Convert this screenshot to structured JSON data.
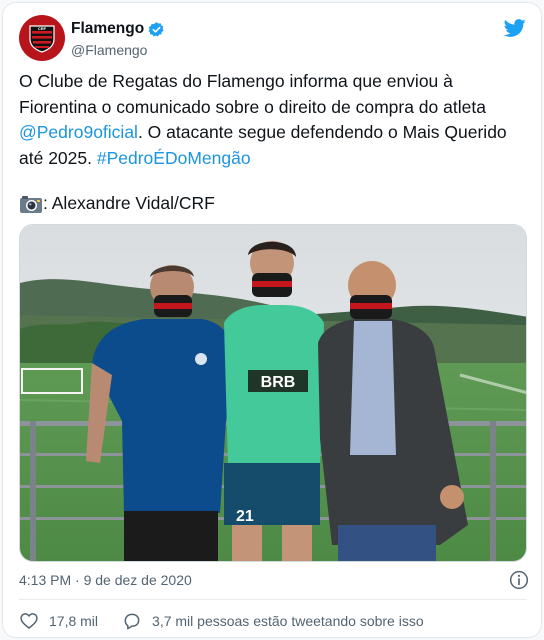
{
  "header": {
    "display_name": "Flamengo",
    "handle": "@Flamengo",
    "avatar_icon": "flamengo-crest-icon",
    "verified_icon": "verified-badge-icon",
    "platform_icon": "twitter-bird-icon"
  },
  "tweet": {
    "text_part1": "O Clube de Regatas do Flamengo informa que enviou à Fiorentina o comunicado sobre o direito de compra do atleta ",
    "mention": "@Pedro9oficial",
    "text_part2": ". O atacante segue defendendo o Mais Querido até 2025. ",
    "hashtag": "#PedroÉDoMengão",
    "credit_icon": "camera-icon",
    "credit_text": ": Alexandre Vidal/CRF"
  },
  "photo": {
    "shirt_sponsor": "BRB",
    "shorts_number": "21"
  },
  "meta": {
    "timestamp": "4:13 PM · 9 de dez de 2020",
    "info_icon": "info-icon"
  },
  "actions": {
    "like_icon": "heart-icon",
    "like_count": "17,8 mil",
    "reply_icon": "comment-icon",
    "reply_text": "3,7 mil pessoas estão tweetando sobre isso"
  },
  "colors": {
    "link": "#1b95e0",
    "flamengo_red": "#b8141c",
    "twitter_blue": "#1da1f2",
    "text_secondary": "#536471"
  }
}
